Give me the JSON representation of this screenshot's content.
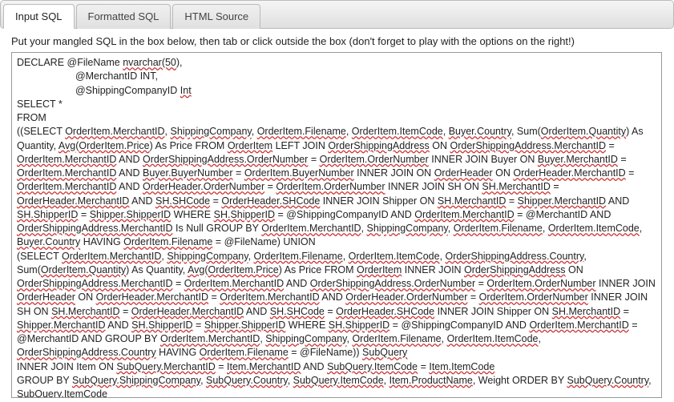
{
  "tabs": {
    "input_sql": "Input SQL",
    "formatted_sql": "Formatted SQL",
    "html_source": "HTML Source"
  },
  "instructions": "Put your mangled SQL in the box below, then tab or click outside the box (don't forget to play with the options on the right!)",
  "sql": {
    "l1": "DECLARE @FileName",
    "l1b": "nvarchar(50",
    "l1c": "),",
    "l2": "@MerchantID INT,",
    "l3": "@ShippingCompanyID",
    "l3b": "Int",
    "l4": "SELECT *",
    "l5": "FROM",
    "p1a": "((SELECT ",
    "t_oi_mid": "OrderItem.MerchantID",
    "sep": ", ",
    "t_sc": "ShippingCompany",
    "t_oi_fn": "OrderItem.Filename",
    "t_oi_ic": "OrderItem.ItemCode",
    "t_b_c": "Buyer.Country",
    "t_sum_pre": "Sum(",
    "t_oi_qty": "OrderItem.Quantity",
    "t_sum_post": ") As Quantity, ",
    "t_avg_pre": "Avg(",
    "t_oi_price": "OrderItem.Price",
    "t_avg_post": ") As Price    FROM ",
    "t_oi": "OrderItem",
    "t_lj": " LEFT JOIN ",
    "t_osa": "OrderShippingAddress",
    "t_on": " ON ",
    "t_osa_mid": "OrderShippingAddress.MerchantID",
    "t_eq": " = ",
    "t_and": " AND ",
    "t_osa_on": "OrderShippingAddress.OrderNumber",
    "t_oi_on": "OrderItem.OrderNumber",
    "t_ij": " INNER JOIN Buyer ON ",
    "t_b_mid": "Buyer.MerchantID",
    "t_b_bn": "Buyer.BuyerNumber",
    "t_oi_bn": "OrderItem.BuyerNumber",
    "t_ijoh": " INNER JOIN ON ",
    "t_oh": "OrderHeader",
    "t_oh_mid": "OrderHeader.MerchantID",
    "t_oh_on": "OrderHeader.OrderNumber",
    "t_ijsh": " INNER JOIN SH ON ",
    "t_sh_mid": "SH.MerchantID",
    "t_sh_shc": "SH.SHCode",
    "t_oh_shc": "OrderHeader.SHCode",
    "t_ijship": " INNER JOIN Shipper ON ",
    "t_shp_mid": "Shipper.MerchantID",
    "t_sh_sid": "SH.ShipperID",
    "t_shp_sid": "Shipper.ShipperID",
    "t_where": " WHERE ",
    "t_scid": " = @ShippingCompanyID AND ",
    "t_mid": " = @MerchantID AND ",
    "t_isnull": " Is Null GROUP BY ",
    "t_hav": " HAVING ",
    "t_fn": " = @FileName) UNION",
    "p2a": " (SELECT ",
    "t_osa_c": "OrderShippingAddress.Country",
    "t_avg_post2": ") As Price FROM ",
    "t_ij2": " INNER JOIN ",
    "t_ijsh2": " INNER JOIN SH ON ",
    "t_ij_ship2": " INNER JOIN Shipper ON ",
    "t_fn2": " = @FileName)) ",
    "t_subq": "SubQuery",
    "p3a": "INNER JOIN Item ON ",
    "t_sq_mid": "SubQuery.MerchantID",
    "t_i_mid": "Item.MerchantID",
    "t_sq_ic": "SubQuery.ItemCode",
    "t_i_ic": "Item.ItemCode",
    "p4a": "GROUP BY ",
    "t_sq_sc": "SubQuery.ShippingCompany",
    "t_sq_c": "SubQuery.Country",
    "t_i_pn": "Item.ProductName",
    "t_w_ob": ", Weight ORDER BY "
  }
}
